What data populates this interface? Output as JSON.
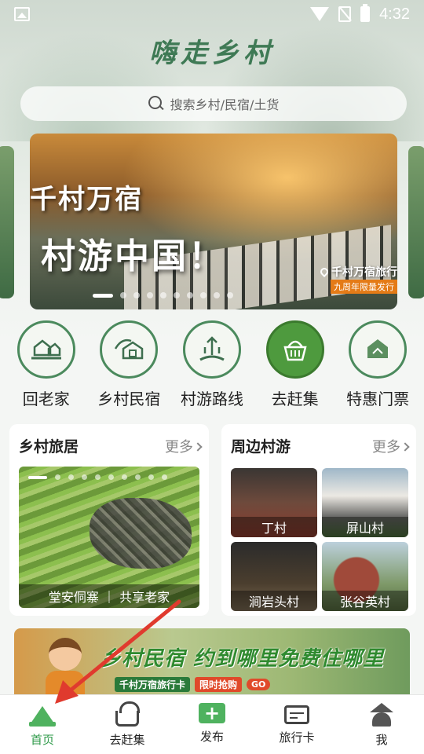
{
  "status_bar": {
    "time": "4:32"
  },
  "header": {
    "title": "嗨走乡村"
  },
  "search": {
    "placeholder": "搜索乡村/民宿/土货"
  },
  "banner": {
    "title_line1": "千村万宿",
    "title_line2": "村游中国！",
    "tag": "千村万宿旅行",
    "subtitle": "九周年限量发行",
    "dot_count": 10,
    "active_dot": 0
  },
  "categories": [
    {
      "label": "回老家",
      "icon": "hometown-house-icon"
    },
    {
      "label": "乡村民宿",
      "icon": "homestay-icon"
    },
    {
      "label": "村游路线",
      "icon": "route-icon"
    },
    {
      "label": "去赶集",
      "icon": "market-basket-icon"
    },
    {
      "label": "特惠门票",
      "icon": "ticket-icon"
    }
  ],
  "rural_stays": {
    "title": "乡村旅居",
    "more": "更多",
    "caption": "堂安侗寨 ｜ 共享老家",
    "dot_count": 10,
    "active_dot": 0
  },
  "nearby": {
    "title": "周边村游",
    "more": "更多",
    "villages": [
      "丁村",
      "屏山村",
      "涧岩头村",
      "张谷英村"
    ]
  },
  "promo": {
    "headline": "乡村民宿 约到哪里免费住哪里",
    "card_label": "千村万宿旅行卡",
    "limited": "限时抢购",
    "go": "GO"
  },
  "tabbar": [
    {
      "label": "首页",
      "icon": "home-mountain-icon",
      "active": true
    },
    {
      "label": "去赶集",
      "icon": "basket-icon",
      "active": false
    },
    {
      "label": "发布",
      "icon": "plus-icon",
      "active": false
    },
    {
      "label": "旅行卡",
      "icon": "card-icon",
      "active": false
    },
    {
      "label": "我",
      "icon": "profile-icon",
      "active": false
    }
  ],
  "colors": {
    "accent": "#4fb25f",
    "title": "#3f7a55",
    "arrow": "#e03a2e"
  }
}
